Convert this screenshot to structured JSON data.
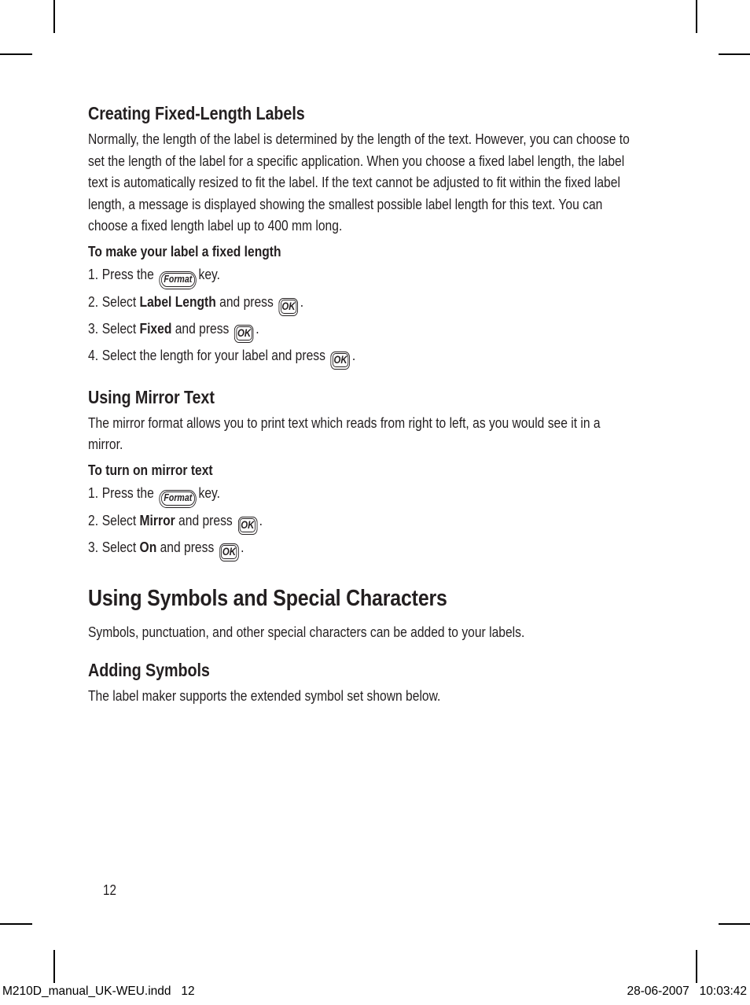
{
  "page": {
    "number": "12",
    "footer_left": "M210D_manual_UK-WEU.indd   12",
    "footer_right": "28-06-2007   10:03:42"
  },
  "keys": {
    "format": "Format",
    "ok": "OK"
  },
  "sections": [
    {
      "id": "creating-fixed-length-labels",
      "heading": "Creating Fixed-Length Labels",
      "body": "Normally, the length of the label is determined by the length of the text. However, you can choose to set the length of the label for a specific application. When you choose a fixed label length, the label text is automatically resized to fit the label. If the text cannot be adjusted to fit within the fixed label length, a message is displayed showing the smallest possible label length for this text. You can choose a fixed length label up to 400 mm long.",
      "subhead": "To make your label a fixed length",
      "steps": [
        {
          "num": "1.",
          "pre": "Press the",
          "key": "format",
          "post": "key."
        },
        {
          "num": "2.",
          "pre": "Select",
          "bold": "Label Length",
          "mid": "and press",
          "key": "ok",
          "post": "."
        },
        {
          "num": "3.",
          "pre": "Select",
          "bold": "Fixed",
          "mid": "and press",
          "key": "ok",
          "post": "."
        },
        {
          "num": "4.",
          "pre": "Select the length for your label and press",
          "key": "ok",
          "post": "."
        }
      ]
    },
    {
      "id": "using-mirror-text",
      "heading": "Using Mirror Text",
      "body": "The mirror format allows you to print text which reads from right to left, as you would see it in a mirror.",
      "subhead": "To turn on mirror text",
      "steps": [
        {
          "num": "1.",
          "pre": "Press the",
          "key": "format",
          "post": "key."
        },
        {
          "num": "2.",
          "pre": "Select",
          "bold": "Mirror",
          "mid": "and press",
          "key": "ok",
          "post": "."
        },
        {
          "num": "3.",
          "pre": "Select",
          "bold": "On",
          "mid": "and press",
          "key": "ok",
          "post": "."
        }
      ]
    },
    {
      "id": "using-symbols-and-special-characters",
      "heading": "Using Symbols and Special Characters",
      "body": "Symbols, punctuation, and other special characters can be added to your labels."
    },
    {
      "id": "adding-symbols",
      "heading": "Adding Symbols",
      "body": "The label maker supports the extended symbol set shown below."
    }
  ]
}
